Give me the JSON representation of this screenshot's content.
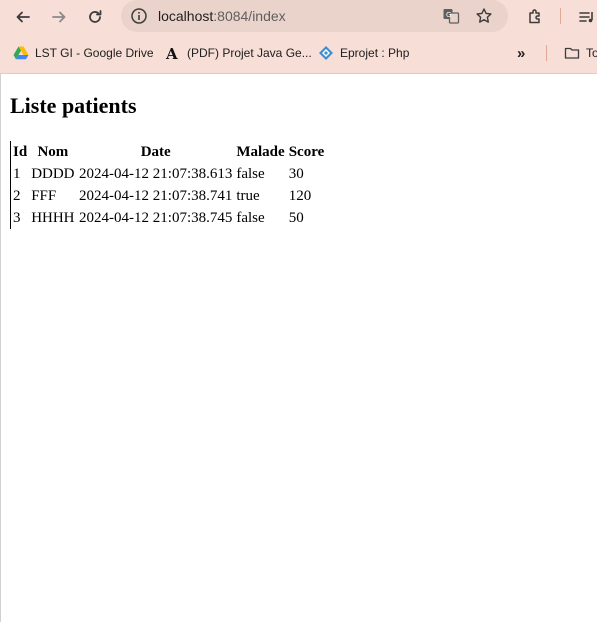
{
  "browser": {
    "url_host": "localhost",
    "url_rest": ":8084/index",
    "icons": [
      "back-icon",
      "forward-icon",
      "reload-icon",
      "info-icon",
      "translate-icon",
      "star-icon",
      "extensions-icon",
      "media-icon"
    ],
    "bookmarks": [
      {
        "label": "LST GI - Google Drive",
        "icon": "google-drive-icon"
      },
      {
        "label": "(PDF) Projet Java Ge...",
        "icon": "academia-icon"
      },
      {
        "label": "Eprojet : Php",
        "icon": "eprojet-icon"
      }
    ],
    "more_bookmarks": "»",
    "folder_label": "To"
  },
  "page": {
    "title": "Liste patients",
    "table": {
      "headers": [
        "Id",
        "Nom",
        "Date",
        "Malade",
        "Score"
      ],
      "rows": [
        [
          "1",
          "DDDD",
          "2024-04-12 21:07:38.613",
          "false",
          "30"
        ],
        [
          "2",
          "FFF",
          "2024-04-12 21:07:38.741",
          "true",
          "120"
        ],
        [
          "3",
          "HHHH",
          "2024-04-12 21:07:38.745",
          "false",
          "50"
        ]
      ]
    }
  }
}
